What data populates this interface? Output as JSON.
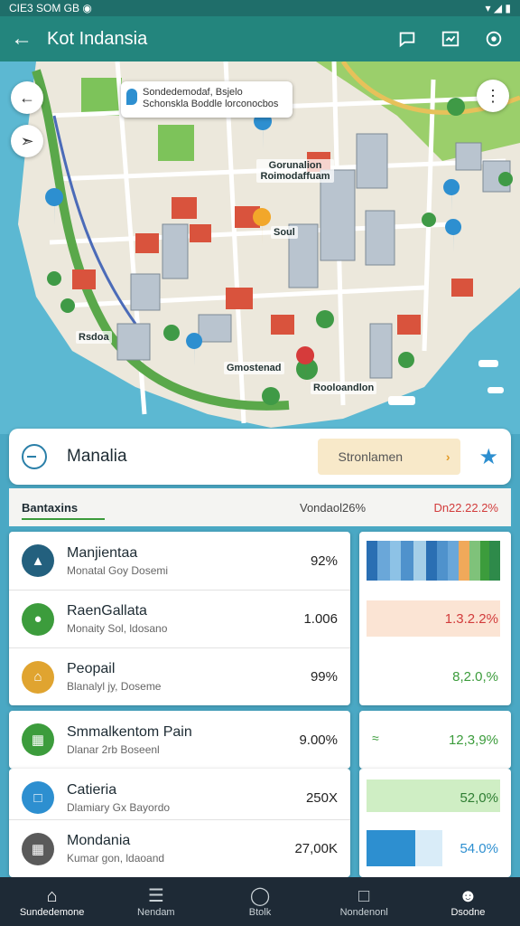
{
  "status": {
    "left": "CIE3 SOM GB ◉",
    "right": "▾ ◢ ▮"
  },
  "appbar": {
    "title": "Kot Indansia"
  },
  "map": {
    "callout": "Sondedemodaf, Bsjelo Schonskla Boddle lorconocbos",
    "labels": [
      "Gorunalion Roimodaffuam",
      "Soul",
      "Rsdoa",
      "Gmostenad",
      "Rooloandlon"
    ]
  },
  "sheet": {
    "title": "Manalia",
    "button": "Stronlamen",
    "tab_left": "Bantaxins",
    "tab_mid": "Vondaol26%",
    "tab_right": "Dn22.22.2%"
  },
  "list": [
    {
      "title": "Manjientaa",
      "sub": "Monatal Goy Dosemi",
      "value": "92%"
    },
    {
      "title": "RaenGallata",
      "sub": "Monaity Sol, ldosano",
      "value": "1.006"
    },
    {
      "title": "Peopail",
      "sub": "Blanalyl jy, Doseme",
      "value": "99%"
    },
    {
      "title": "Smmalkentom Pain",
      "sub": "Dlanar 2rb Boseenl",
      "value": "9.00%"
    },
    {
      "title": "Catieria",
      "sub": "Dlamiary Gx Bayordo",
      "value": "250X"
    },
    {
      "title": "Mondania",
      "sub": "Kumar gon, ldaoand",
      "value": "27,00K"
    }
  ],
  "stats": [
    "1.3.2.2%",
    "8,2.0,%",
    "12,3,9%",
    "52,0%",
    "54.0%"
  ],
  "nav": [
    "Sundedemone",
    "Nendam",
    "Btolk",
    "Nondenonl",
    "Dsodne"
  ],
  "colors": {
    "primary": "#23857d",
    "accent": "#2d8fd0",
    "nav": "#1e2a36"
  },
  "icons": [
    "back-arrow-icon",
    "chat-icon",
    "chart-icon",
    "settings-icon"
  ]
}
